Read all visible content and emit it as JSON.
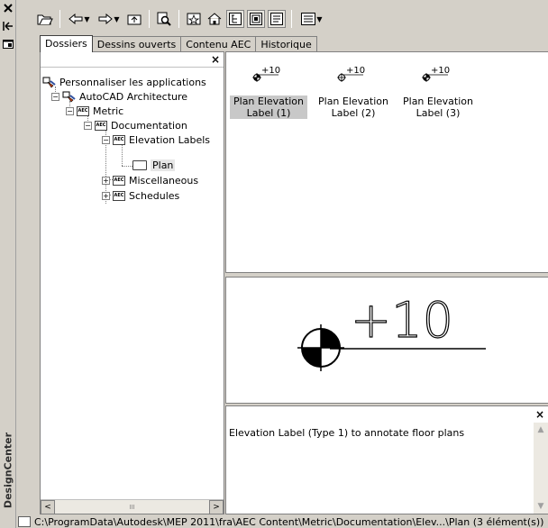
{
  "palette": "DesignCenter",
  "strip": {
    "close_icon": "close-icon",
    "autohide_icon": "autohide-icon",
    "properties_icon": "properties-icon",
    "title": "DesignCenter"
  },
  "toolbar": {
    "icons": [
      "load-icon",
      "back-icon",
      "forward-icon",
      "up-icon",
      "search-icon",
      "favorites-icon",
      "home-icon",
      "tree-view-toggle-icon",
      "preview-toggle-icon",
      "description-toggle-icon",
      "views-icon"
    ]
  },
  "tabs": [
    {
      "label": "Dossiers",
      "active": true
    },
    {
      "label": "Dessins ouverts",
      "active": false
    },
    {
      "label": "Contenu AEC",
      "active": false
    },
    {
      "label": "Historique",
      "active": false
    }
  ],
  "tree": {
    "close_label": "×",
    "items": [
      {
        "label": "Personnaliser les applications"
      },
      {
        "label": "AutoCAD Architecture"
      },
      {
        "label": "Metric"
      },
      {
        "label": "Documentation"
      },
      {
        "label": "Elevation Labels"
      },
      {
        "label": "Plan"
      },
      {
        "label": "Miscellaneous"
      },
      {
        "label": "Schedules"
      }
    ],
    "aec_text": "AEC",
    "scroll_left": "<",
    "scroll_right": ">",
    "scroll_thumb": "III"
  },
  "content": {
    "items": [
      {
        "label": "Plan Elevation Label (1)",
        "value": "+10",
        "selected": true
      },
      {
        "label": "Plan Elevation Label (2)",
        "value": "+10",
        "selected": false
      },
      {
        "label": "Plan Elevation Label (3)",
        "value": "+10",
        "selected": false
      }
    ]
  },
  "preview": {
    "value": "+10"
  },
  "description": {
    "text": "Elevation Label (Type 1) to annotate floor plans",
    "close_label": "×"
  },
  "status": {
    "path": "C:\\ProgramData\\Autodesk\\MEP 2011\\fra\\AEC Content\\Metric\\Documentation\\Elev...\\Plan (3 élément(s))"
  },
  "colors": {
    "chrome": "#d4d0c8",
    "panel": "#ffffff",
    "selection": "#c8c8c8"
  }
}
